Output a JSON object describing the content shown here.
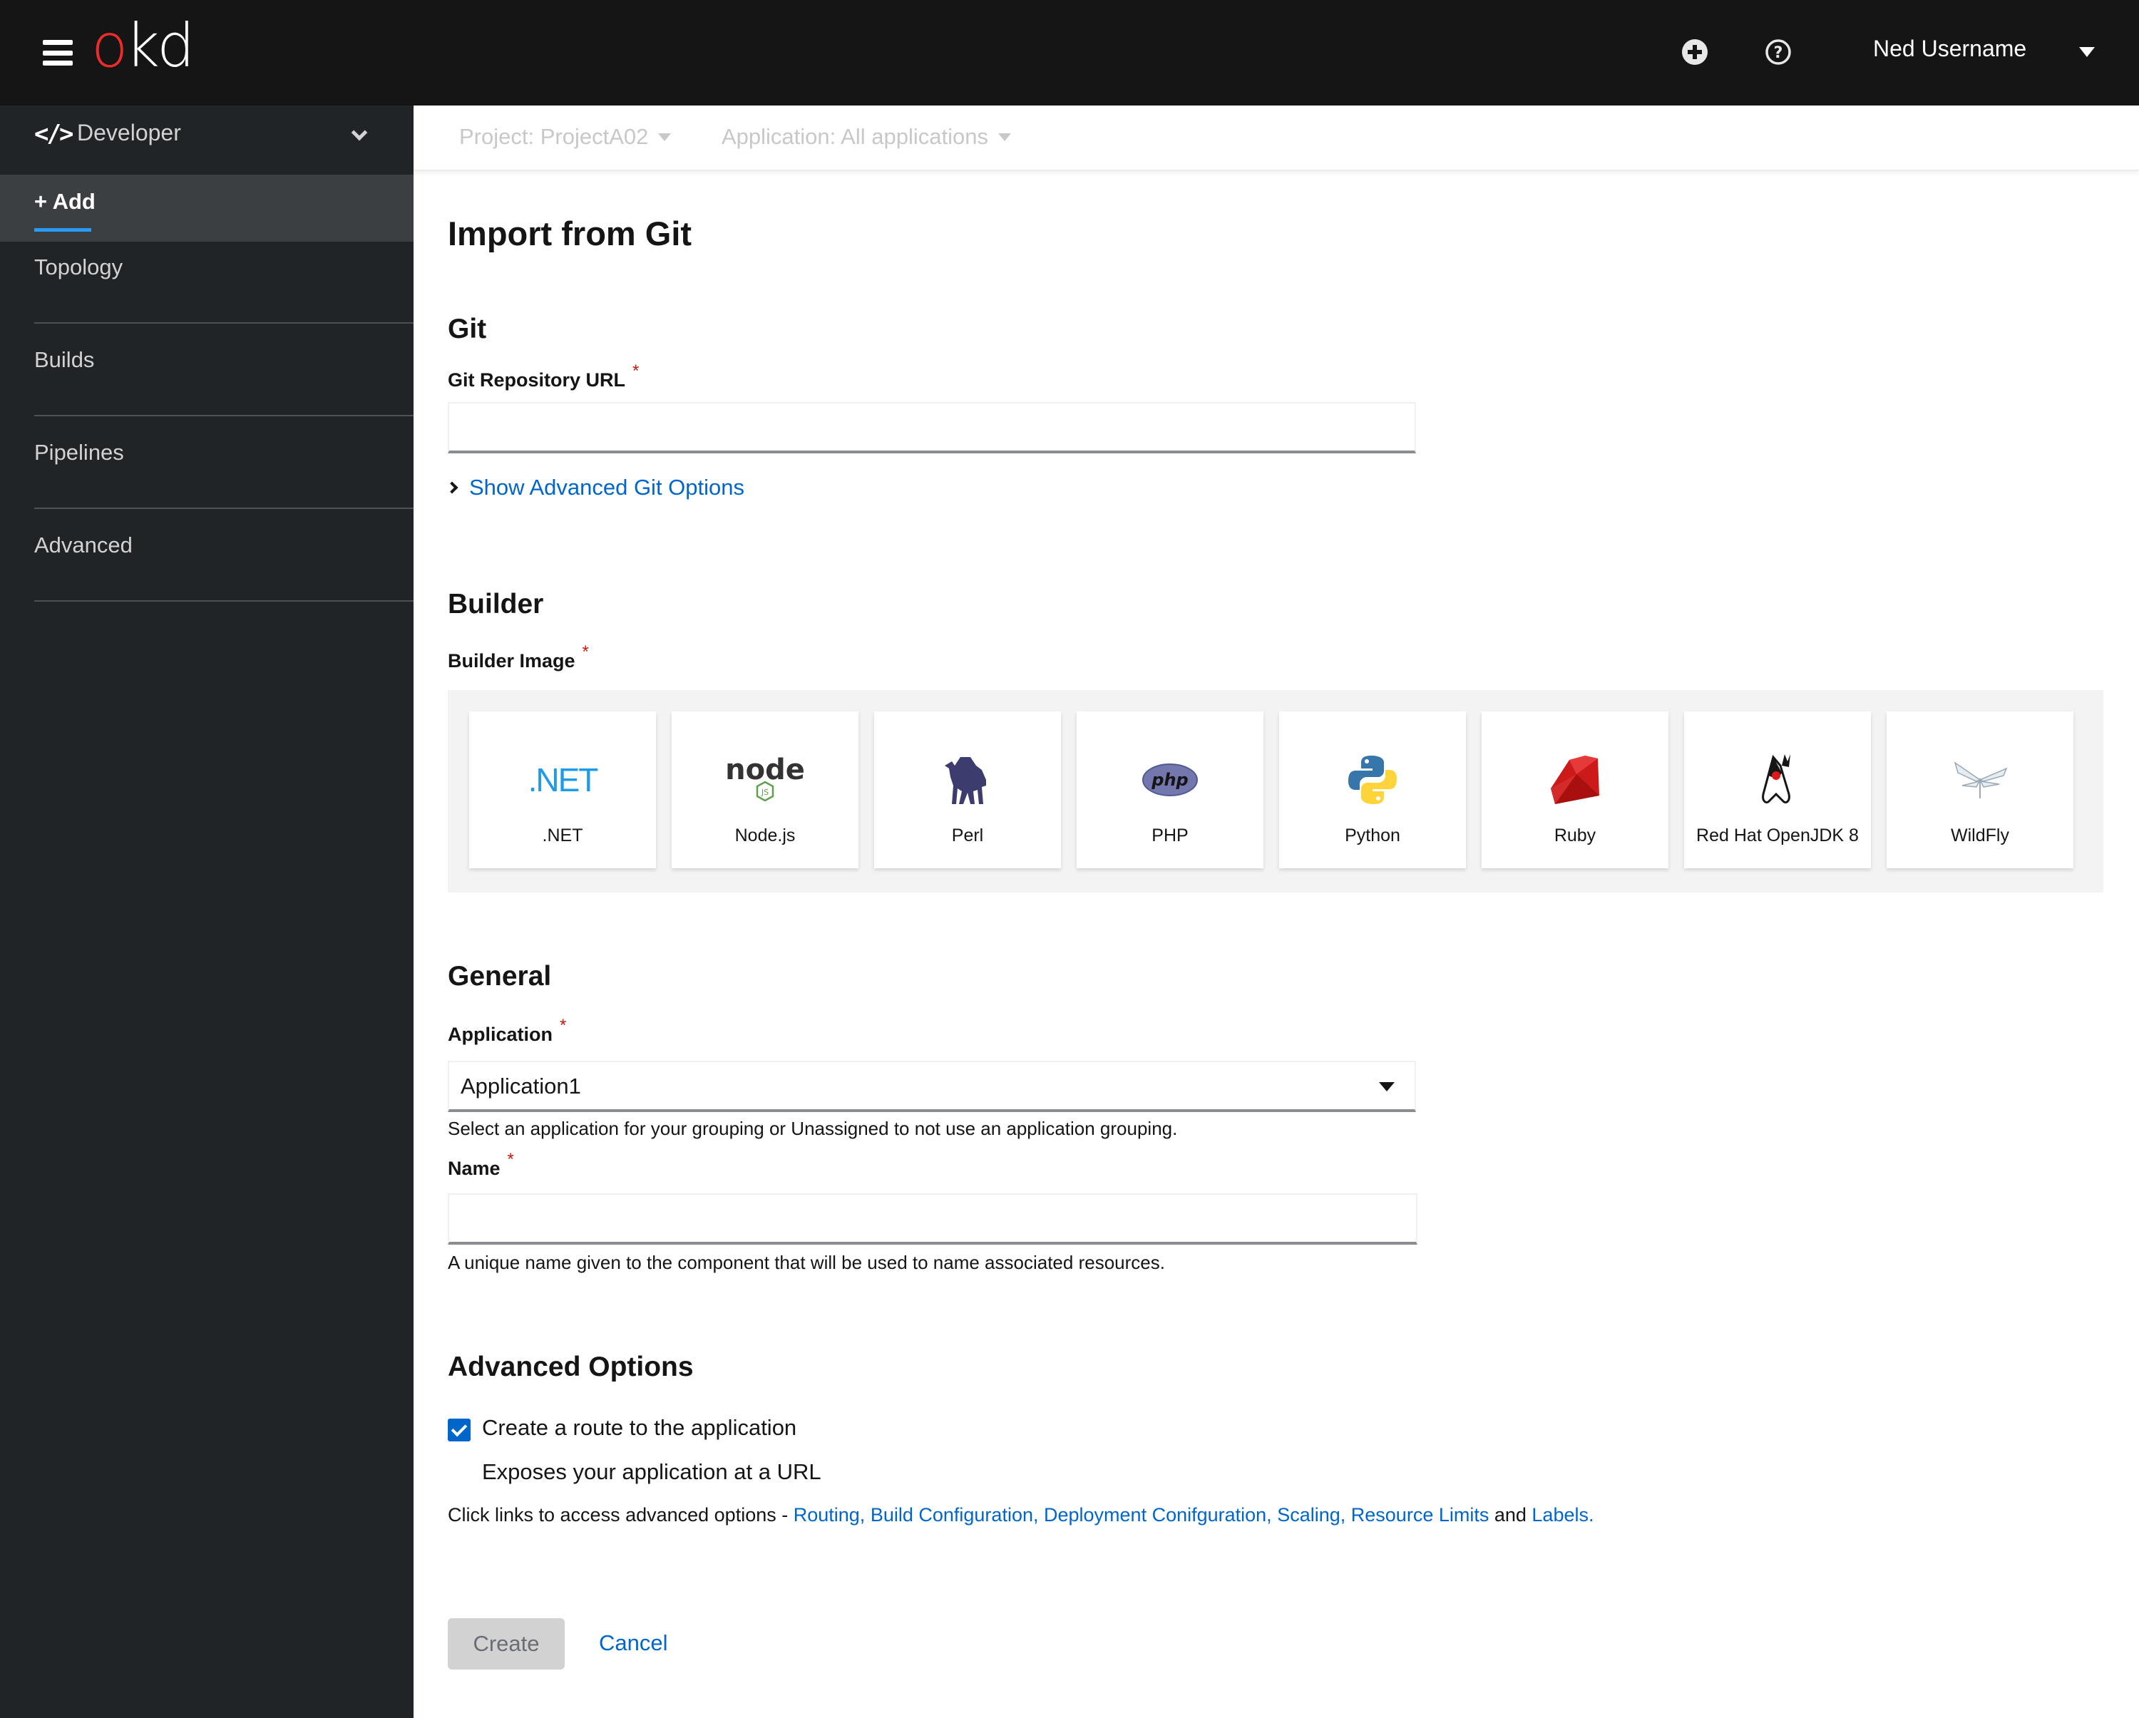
{
  "masthead": {
    "logo_o": "o",
    "logo_kd": "kd",
    "user_name": "Ned Username",
    "icons": [
      "grid-icon",
      "plus-circle-icon",
      "help-icon",
      "caret-down-icon"
    ]
  },
  "sidebar": {
    "perspective_icon": "</>",
    "perspective_label": "Developer",
    "items": [
      {
        "label": "+ Add",
        "active": true
      },
      {
        "label": "Topology",
        "active": false
      },
      {
        "label": "Builds",
        "active": false
      },
      {
        "label": "Pipelines",
        "active": false
      },
      {
        "label": "Advanced",
        "active": false
      }
    ]
  },
  "context": {
    "project": "Project: ProjectA02",
    "application": "Application: All applications"
  },
  "page": {
    "title": "Import from Git",
    "git": {
      "section": "Git",
      "url_label": "Git Repository URL",
      "url_value": "",
      "required_mark": "*",
      "advanced_toggle": "Show Advanced Git Options"
    },
    "builder": {
      "section": "Builder",
      "image_label": "Builder Image",
      "images": [
        {
          "label": ".NET",
          "icon": "dotnet-icon"
        },
        {
          "label": "Node.js",
          "icon": "nodejs-icon"
        },
        {
          "label": "Perl",
          "icon": "perl-camel-icon"
        },
        {
          "label": "PHP",
          "icon": "php-icon"
        },
        {
          "label": "Python",
          "icon": "python-icon"
        },
        {
          "label": "Ruby",
          "icon": "ruby-icon"
        },
        {
          "label": "Red Hat OpenJDK 8",
          "icon": "java-duke-icon"
        },
        {
          "label": "WildFly",
          "icon": "wildfly-icon"
        }
      ],
      "dotnet_text": ".NET",
      "node_text": "node",
      "php_text": "php"
    },
    "general": {
      "section": "General",
      "application_label": "Application",
      "application_value": "Application1",
      "application_help": "Select an application for your grouping or Unassigned to not use an application grouping.",
      "name_label": "Name",
      "name_value": "",
      "name_help": "A unique name given to the component that will be used to name associated resources."
    },
    "advanced": {
      "section": "Advanced Options",
      "route_checkbox_label": "Create a route to the application",
      "route_checked": true,
      "route_description": "Exposes your application at a URL",
      "links_prefix": "Click links to access advanced options - ",
      "links": [
        "Routing,",
        "Build Configuration,",
        "Deployment Conifguration,",
        "Scaling,",
        "Resource Limits"
      ],
      "links_and": " and ",
      "last_link": "Labels."
    },
    "actions": {
      "create": "Create",
      "cancel": "Cancel"
    }
  },
  "colors": {
    "masthead_bg": "#151515",
    "sidebar_bg": "#212427",
    "active_nav_bg": "#3c3f42",
    "active_indicator": "#2b9af3",
    "link": "#0066cc",
    "required": "#c9190b",
    "logo_red": "#ee2b2b"
  }
}
